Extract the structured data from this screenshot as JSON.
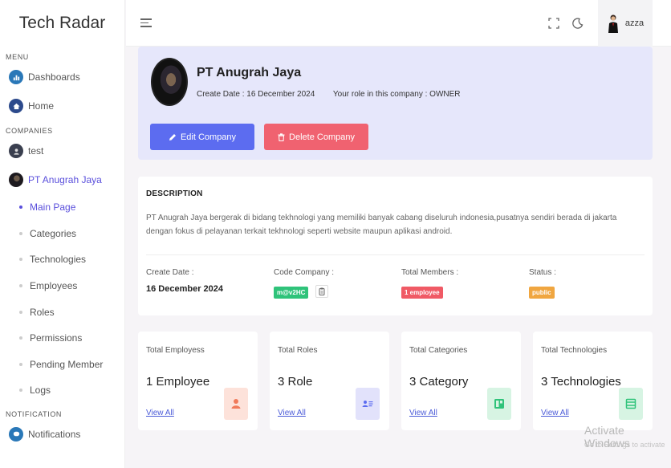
{
  "app": {
    "brand": "Tech Radar"
  },
  "sidebar": {
    "menu_label": "MENU",
    "menu_items": [
      {
        "label": "Dashboards",
        "icon": "dashboard-icon"
      },
      {
        "label": "Home",
        "icon": "home-icon"
      }
    ],
    "companies_label": "COMPANIES",
    "companies": [
      {
        "label": "test"
      },
      {
        "label": "PT Anugrah Jaya",
        "active": true
      }
    ],
    "sub_items": [
      {
        "label": "Main Page",
        "active": true
      },
      {
        "label": "Categories"
      },
      {
        "label": "Technologies"
      },
      {
        "label": "Employees"
      },
      {
        "label": "Roles"
      },
      {
        "label": "Permissions"
      },
      {
        "label": "Pending Member"
      },
      {
        "label": "Logs"
      }
    ],
    "notification_label": "NOTIFICATION",
    "notification_items": [
      {
        "label": "Notifications",
        "icon": "notification-icon"
      }
    ]
  },
  "topbar": {
    "username": "azza"
  },
  "company": {
    "name": "PT Anugrah Jaya",
    "create_date_text": "Create Date : 16 December 2024",
    "role_text": "Your role in this company : OWNER",
    "edit_label": "Edit Company",
    "delete_label": "Delete Company"
  },
  "description": {
    "title": "DESCRIPTION",
    "text": "PT Anugrah Jaya bergerak di bidang tekhnologi yang memiliki banyak cabang diseluruh indonesia,pusatnya sendiri berada di jakarta dengan fokus di pelayanan terkait tekhnologi seperti website maupun aplikasi android.",
    "create_date_label": "Create Date :",
    "create_date_value": "16 December 2024",
    "code_label": "Code Company :",
    "code_value": "m@v2HC",
    "members_label": "Total Members :",
    "members_value": "1 employee",
    "status_label": "Status :",
    "status_value": "public"
  },
  "stats": [
    {
      "label": "Total Employess",
      "value": "1 Employee",
      "link": "View All",
      "icon": "user-icon",
      "color": "#f07a5a"
    },
    {
      "label": "Total Roles",
      "value": "3 Role",
      "link": "View All",
      "icon": "id-card-icon",
      "color": "#5c6cf0"
    },
    {
      "label": "Total Categories",
      "value": "3 Category",
      "link": "View All",
      "icon": "category-icon",
      "color": "#2fc37a"
    },
    {
      "label": "Total Technologies",
      "value": "3 Technologies",
      "link": "View All",
      "icon": "technology-icon",
      "color": "#2fc37a"
    }
  ],
  "watermark": {
    "title": "Activate Windows",
    "subtitle": "Go to Settings to activate Windows."
  },
  "colors": {
    "accent": "#5a4fdc",
    "edit_button": "#5c6cf0",
    "delete_button": "#f06270",
    "header_bg": "#e6e7fb"
  }
}
